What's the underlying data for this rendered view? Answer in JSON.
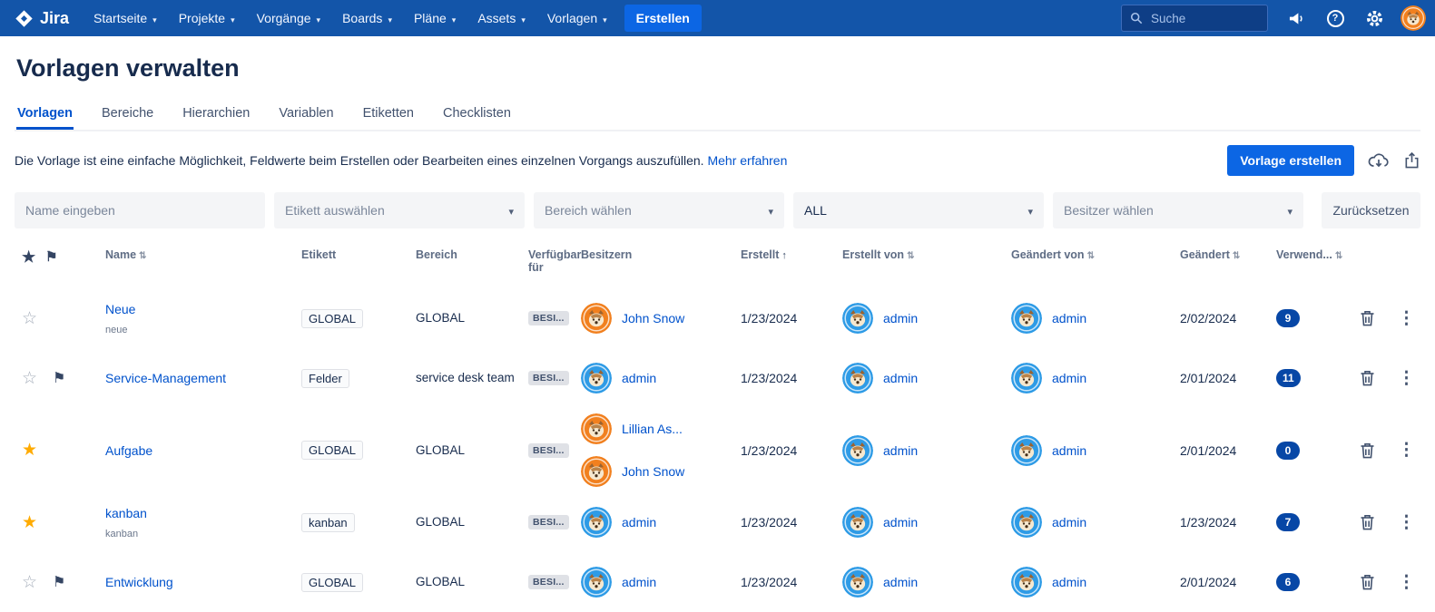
{
  "colors": {
    "accent": "#0052CC",
    "navbar_bg": "#1355A9",
    "create_button_blue": "#0C66E4",
    "avatar_orange": "#F1801F",
    "avatar_blue": "#2E9BE6",
    "star_yellow": "#FFAB00",
    "flag_navy": "#344563",
    "count_badge_navy": "#0747A6"
  },
  "navbar": {
    "brand": "Jira",
    "items": [
      {
        "label": "Startseite"
      },
      {
        "label": "Projekte"
      },
      {
        "label": "Vorgänge"
      },
      {
        "label": "Boards"
      },
      {
        "label": "Pläne"
      },
      {
        "label": "Assets"
      },
      {
        "label": "Vorlagen"
      }
    ],
    "create_button": "Erstellen",
    "search_placeholder": "Suche"
  },
  "page": {
    "title": "Vorlagen verwalten",
    "tabs": [
      {
        "label": "Vorlagen"
      },
      {
        "label": "Bereiche"
      },
      {
        "label": "Hierarchien"
      },
      {
        "label": "Variablen"
      },
      {
        "label": "Etiketten"
      },
      {
        "label": "Checklisten"
      }
    ],
    "description": "Die Vorlage ist eine einfache Möglichkeit, Feldwerte beim Erstellen oder Bearbeiten eines einzelnen Vorgangs auszufüllen.",
    "learn_more": "Mehr erfahren",
    "create_template_button": "Vorlage erstellen"
  },
  "filters": {
    "name_placeholder": "Name eingeben",
    "label_select": "Etikett auswählen",
    "scope_select": "Bereich wählen",
    "availability_select": "ALL",
    "owner_select": "Besitzer wählen",
    "reset_button": "Zurücksetzen"
  },
  "table": {
    "columns": {
      "name": "Name",
      "label": "Etikett",
      "scope": "Bereich",
      "available": "Verfügbar für",
      "owners": "Besitzern",
      "created": "Erstellt",
      "created_by": "Erstellt von",
      "modified_by": "Geändert von",
      "modified": "Geändert",
      "usage": "Verwend..."
    },
    "rows": [
      {
        "starred": false,
        "flagged": false,
        "name": "Neue",
        "name_sub": "neue",
        "label": "GLOBAL",
        "scope": "GLOBAL",
        "available": "BESI...",
        "owners": [
          {
            "name": "John Snow",
            "color": "orange"
          }
        ],
        "created": "1/23/2024",
        "created_by": {
          "name": "admin",
          "color": "blue"
        },
        "modified_by": {
          "name": "admin",
          "color": "blue"
        },
        "modified": "2/02/2024",
        "usage": "9"
      },
      {
        "starred": false,
        "flagged": true,
        "name": "Service-Management",
        "name_sub": "",
        "label": "Felder",
        "scope": "service desk team",
        "available": "BESI...",
        "owners": [
          {
            "name": "admin",
            "color": "blue"
          }
        ],
        "created": "1/23/2024",
        "created_by": {
          "name": "admin",
          "color": "blue"
        },
        "modified_by": {
          "name": "admin",
          "color": "blue"
        },
        "modified": "2/01/2024",
        "usage": "11"
      },
      {
        "starred": true,
        "flagged": false,
        "name": "Aufgabe",
        "name_sub": "",
        "label": "GLOBAL",
        "scope": "GLOBAL",
        "available": "BESI...",
        "owners": [
          {
            "name": "Lillian As...",
            "color": "orange"
          },
          {
            "name": "John Snow",
            "color": "orange"
          }
        ],
        "created": "1/23/2024",
        "created_by": {
          "name": "admin",
          "color": "blue"
        },
        "modified_by": {
          "name": "admin",
          "color": "blue"
        },
        "modified": "2/01/2024",
        "usage": "0"
      },
      {
        "starred": true,
        "flagged": false,
        "name": "kanban",
        "name_sub": "kanban",
        "label": "kanban",
        "scope": "GLOBAL",
        "available": "BESI...",
        "owners": [
          {
            "name": "admin",
            "color": "blue"
          }
        ],
        "created": "1/23/2024",
        "created_by": {
          "name": "admin",
          "color": "blue"
        },
        "modified_by": {
          "name": "admin",
          "color": "blue"
        },
        "modified": "1/23/2024",
        "usage": "7"
      },
      {
        "starred": false,
        "flagged": true,
        "name": "Entwicklung",
        "name_sub": "",
        "label": "GLOBAL",
        "scope": "GLOBAL",
        "available": "BESI...",
        "owners": [
          {
            "name": "admin",
            "color": "blue"
          }
        ],
        "created": "1/23/2024",
        "created_by": {
          "name": "admin",
          "color": "blue"
        },
        "modified_by": {
          "name": "admin",
          "color": "blue"
        },
        "modified": "2/01/2024",
        "usage": "6"
      }
    ]
  }
}
